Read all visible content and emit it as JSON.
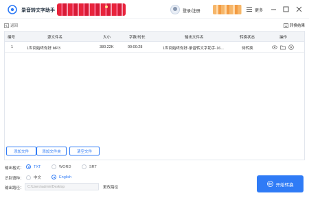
{
  "app": {
    "title": "录音转文字助手"
  },
  "header": {
    "login_label": "登录/注册",
    "more_label": "更多"
  },
  "toolbar": {
    "back_label": "返回",
    "results_label": "转换结果"
  },
  "table": {
    "columns": [
      "编号",
      "源文件名",
      "大小",
      "字数/时长",
      "输出文件名",
      "转换状态",
      "操作"
    ],
    "rows": [
      {
        "index": "1",
        "source": "1世间始终你好.MP3",
        "size": "380.22K",
        "duration": "00:00:28",
        "output": "1世间始终你好-录音转文字助手-16...",
        "status": "待转换"
      }
    ]
  },
  "actions": {
    "add_file": "添加文件",
    "add_folder": "添加文件夹",
    "clear_files": "清空文件"
  },
  "settings": {
    "format_label": "输出格式：",
    "formats": [
      "TXT",
      "WORD",
      "SRT"
    ],
    "language_label": "识别语种：",
    "languages": [
      "中文",
      "English"
    ],
    "path_label": "输出路径：",
    "path_value": "C:\\Users\\admin\\Desktop",
    "change_path_label": "更改路径"
  },
  "start_button": {
    "label": "开始转换"
  },
  "colors": {
    "accent": "#2f7bf6",
    "header_bg": "#f2f4f7"
  },
  "icons": [
    "app-logo-icon",
    "avatar",
    "more-icon",
    "minimize-icon",
    "maximize-icon",
    "close-icon",
    "back-icon",
    "results-icon",
    "preview-icon",
    "folder-icon",
    "delete-icon",
    "start-convert-icon"
  ]
}
